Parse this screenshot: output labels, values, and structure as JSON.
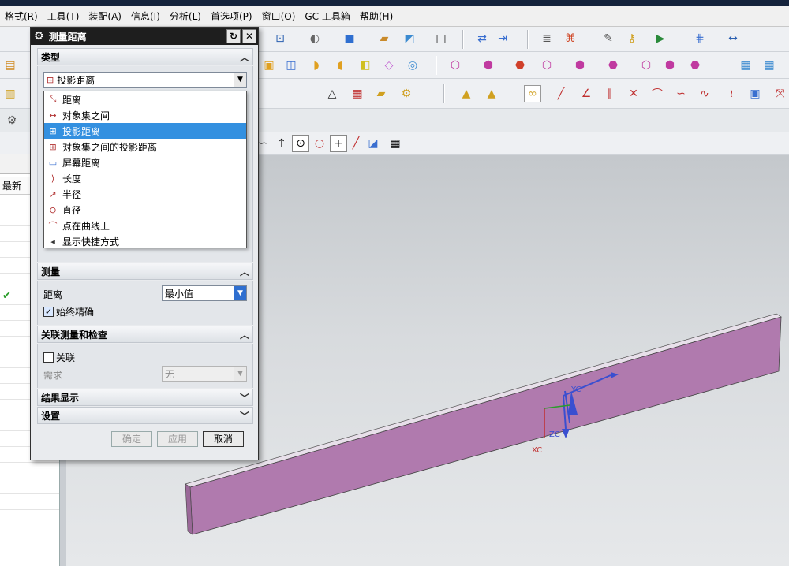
{
  "menu": [
    "格式(R)",
    "工具(T)",
    "装配(A)",
    "信息(I)",
    "分析(L)",
    "首选项(P)",
    "窗口(O)",
    "GC 工具箱",
    "帮助(H)"
  ],
  "dialog": {
    "title": "测量距离",
    "section_type": "类型",
    "type_value": "投影距离",
    "type_options": [
      "距离",
      "对象集之间",
      "投影距离",
      "对象集之间的投影距离",
      "屏幕距离",
      "长度",
      "半径",
      "直径",
      "点在曲线上",
      "显示快捷方式"
    ],
    "selected_option": 2,
    "section_measure": "测量",
    "distance_label": "距离",
    "distance_value": "最小值",
    "always_precise": "始终精确",
    "section_assoc": "关联测量和检查",
    "assoc_label": "关联",
    "require_label": "需求",
    "require_value": "无",
    "section_result": "结果显示",
    "section_settings": "设置",
    "ok": "确定",
    "apply": "应用",
    "cancel": "取消"
  },
  "navigator": {
    "column": "最新"
  },
  "axes": {
    "xc": "XC",
    "yc": "YC",
    "zc": "ZC"
  },
  "colors": {
    "part": "#b07aae",
    "selection": "#3390e0",
    "title_bar": "#1e1e1e"
  }
}
